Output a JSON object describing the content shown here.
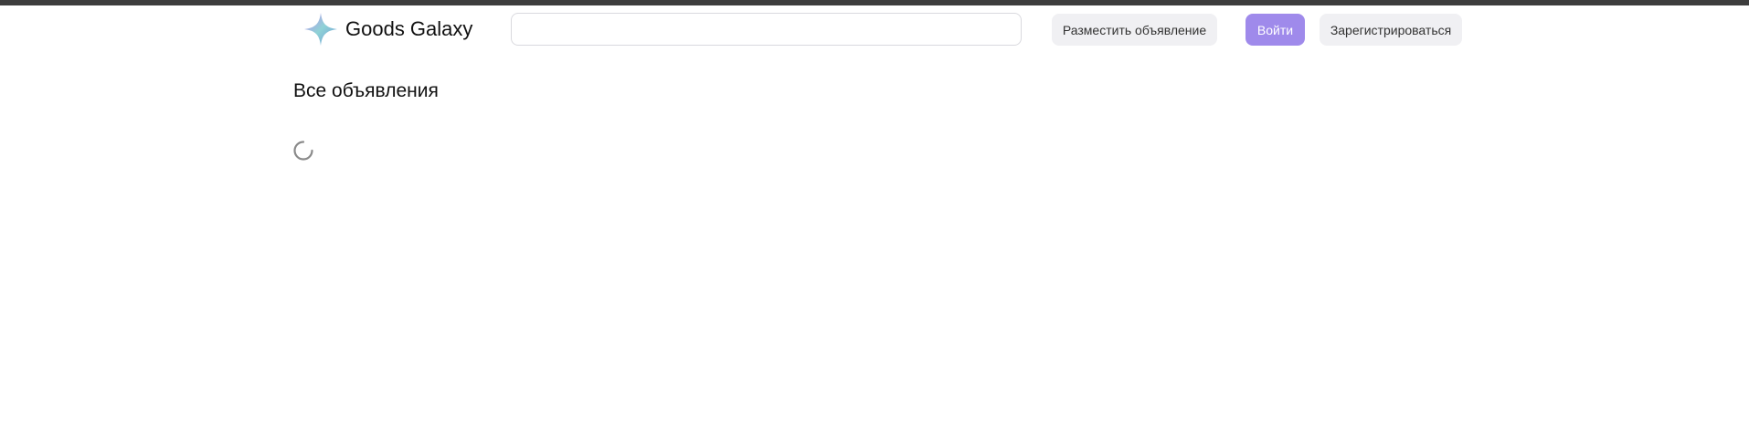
{
  "header": {
    "brand_name": "Goods Galaxy",
    "logo_icon": "four-point-star-icon",
    "search": {
      "value": "",
      "placeholder": ""
    },
    "post_ad_label": "Разместить объявление",
    "login_label": "Войти",
    "register_label": "Зарегистрироваться"
  },
  "main": {
    "title": "Все объявления",
    "loading_icon": "loading-spinner-icon"
  },
  "colors": {
    "accent": "#9f8aeb",
    "button_secondary_bg": "#f0f0f3",
    "top_bar": "#3d3d3d",
    "spinner": "#8a8a8a"
  }
}
